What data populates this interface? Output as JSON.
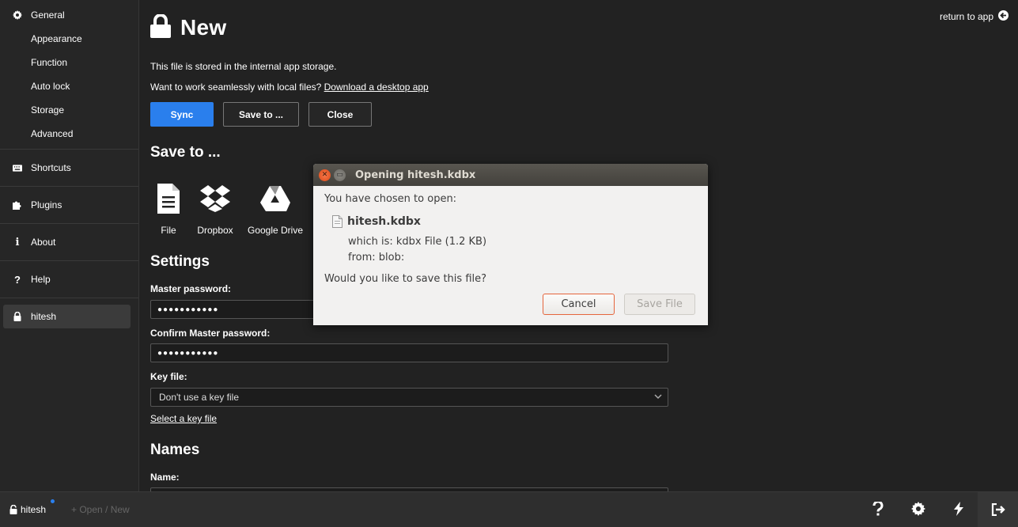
{
  "sidebar": {
    "general": "General",
    "appearance": "Appearance",
    "function": "Function",
    "auto_lock": "Auto lock",
    "storage": "Storage",
    "advanced": "Advanced",
    "shortcuts": "Shortcuts",
    "plugins": "Plugins",
    "about": "About",
    "help": "Help",
    "file": "hitesh"
  },
  "header": {
    "title": "New",
    "return_link": "return to app"
  },
  "main": {
    "info_storage": "This file is stored in the internal app storage.",
    "info_local_prefix": "Want to work seamlessly with local files?",
    "info_local_link": "Download a desktop app",
    "buttons": {
      "sync": "Sync",
      "save_to": "Save to ...",
      "close": "Close"
    },
    "save_to_heading": "Save to ...",
    "storage_options": {
      "file": "File",
      "dropbox": "Dropbox",
      "google_drive": "Google Drive"
    },
    "settings_heading": "Settings",
    "master_password_label": "Master password:",
    "master_password_value": "●●●●●●●●●●●",
    "confirm_password_label": "Confirm Master password:",
    "confirm_password_value": "●●●●●●●●●●●",
    "key_file_label": "Key file:",
    "key_file_value": "Don't use a key file",
    "select_key_file_link": "Select a key file",
    "names_heading": "Names",
    "name_label": "Name:"
  },
  "footer": {
    "file": "hitesh",
    "open_new": "Open / New"
  },
  "dialog": {
    "title": "Opening hitesh.kdbx",
    "chosen": "You have chosen to open:",
    "file_name": "hitesh.kdbx",
    "which_is": "which is:  kdbx File (1.2 KB)",
    "from": "from:  blob:",
    "question": "Would you like to save this file?",
    "cancel": "Cancel",
    "save_file": "Save File"
  },
  "colors": {
    "accent": "#2a7fed",
    "background": "#222222",
    "dialog_bg": "#f2f1f0"
  }
}
